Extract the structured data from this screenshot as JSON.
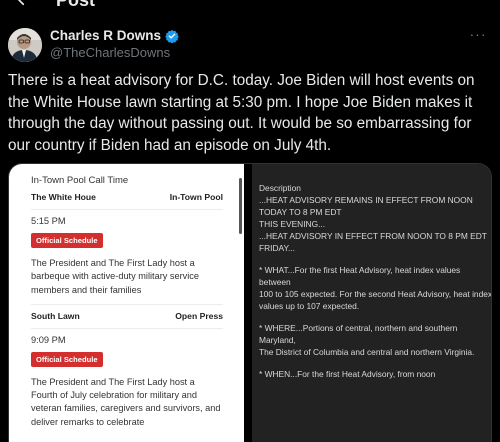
{
  "header": {
    "title": "Post"
  },
  "post": {
    "display_name": "Charles R Downs",
    "handle": "@TheCharlesDowns",
    "text": "There is a heat advisory for D.C. today. Joe Biden will host events on the White House lawn starting at 5:30 pm. I hope Joe Biden makes it through the day without passing out. It would be so embarrassing for our country if Biden had an episode on July 4th.",
    "more": "···"
  },
  "colors": {
    "verified": "#1d9bf0",
    "badge_red": "#d32f2f",
    "handle_gray": "#71767b"
  },
  "schedule": {
    "title": "In-Town Pool Call Time",
    "events": [
      {
        "location": "The White Houe",
        "coverage": "In-Town Pool",
        "time": "5:15 PM",
        "badge": "Official Schedule",
        "description": "The President and The First Lady host a barbeque with active-duty military service members and their families"
      },
      {
        "location": "South Lawn",
        "coverage": "Open Press",
        "time": "9:09 PM",
        "badge": "Official Schedule",
        "description": "The President and The First Lady host a Fourth of July celebration for military and veteran families, caregivers and survivors, and deliver remarks to celebrate"
      }
    ]
  },
  "advisory": {
    "heading": "Description",
    "paragraphs": [
      "...HEAT ADVISORY REMAINS IN EFFECT FROM NOON TODAY TO 8 PM EDT\nTHIS EVENING...\n...HEAT ADVISORY IN EFFECT FROM NOON TO 8 PM EDT FRIDAY...",
      "* WHAT...For the first Heat Advisory, heat index values between\n100 to 105 expected. For the second Heat Advisory, heat index\nvalues up to 107 expected.",
      "* WHERE...Portions of central, northern and southern Maryland,\nThe District of Columbia and central and northern Virginia.",
      "* WHEN...For the first Heat Advisory, from noon"
    ]
  }
}
